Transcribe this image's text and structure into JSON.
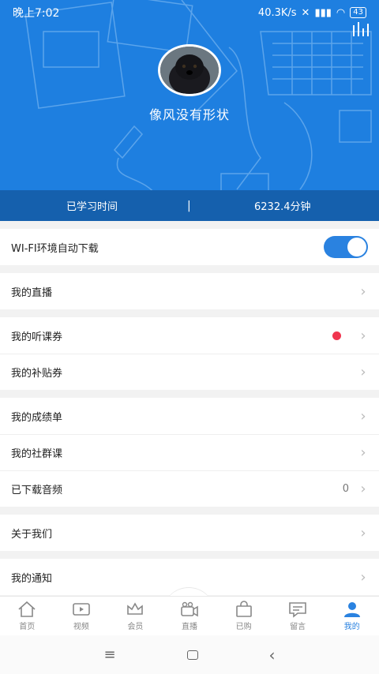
{
  "status": {
    "time": "晚上7:02",
    "speed": "40.3K/s",
    "battery": "43"
  },
  "profile": {
    "nickname": "像风没有形状"
  },
  "study": {
    "label": "已学习时间",
    "separator": "|",
    "value": "6232.4分钟"
  },
  "settings": {
    "wifi_label": "WI-FI环境自动下载",
    "wifi_on": true
  },
  "menu": {
    "live": "我的直播",
    "coupon": "我的听课券",
    "subsidy": "我的补贴券",
    "report": "我的成绩单",
    "community": "我的社群课",
    "downloaded": "已下载音频",
    "downloaded_count": "0",
    "about": "关于我们",
    "notice": "我的通知"
  },
  "tabs": [
    {
      "label": "首页",
      "icon": "home-icon"
    },
    {
      "label": "视频",
      "icon": "video-icon"
    },
    {
      "label": "会员",
      "icon": "crown-icon"
    },
    {
      "label": "直播",
      "icon": "camera-icon"
    },
    {
      "label": "已购",
      "icon": "bag-icon"
    },
    {
      "label": "留言",
      "icon": "message-icon"
    },
    {
      "label": "我的",
      "icon": "user-icon"
    }
  ],
  "colors": {
    "brand": "#1e7fe0",
    "study_bar": "#1560ad",
    "badge": "#f0354f"
  }
}
